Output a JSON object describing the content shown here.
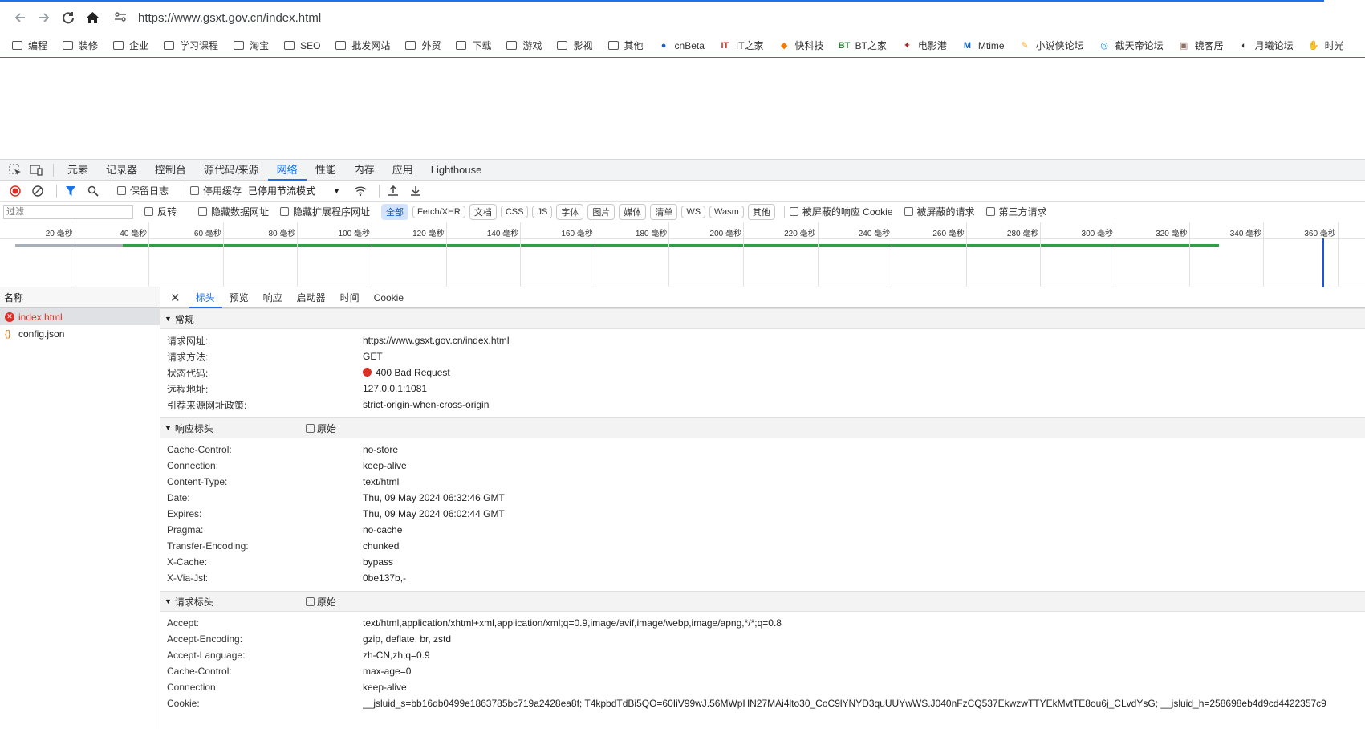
{
  "browser": {
    "url": "https://www.gsxt.gov.cn/index.html",
    "bookmarks": [
      {
        "label": "编程",
        "icon": "folder-icon"
      },
      {
        "label": "装修",
        "icon": "folder-icon"
      },
      {
        "label": "企业",
        "icon": "folder-icon"
      },
      {
        "label": "学习课程",
        "icon": "folder-icon"
      },
      {
        "label": "淘宝",
        "icon": "folder-icon"
      },
      {
        "label": "SEO",
        "icon": "folder-icon"
      },
      {
        "label": "批发网站",
        "icon": "folder-icon"
      },
      {
        "label": "外贸",
        "icon": "folder-icon"
      },
      {
        "label": "下载",
        "icon": "folder-icon"
      },
      {
        "label": "游戏",
        "icon": "folder-icon"
      },
      {
        "label": "影视",
        "icon": "folder-icon"
      },
      {
        "label": "其他",
        "icon": "folder-icon"
      },
      {
        "label": "cnBeta",
        "icon": "cnbeta-icon"
      },
      {
        "label": "IT之家",
        "icon": "ithome-icon"
      },
      {
        "label": "快科技",
        "icon": "kkj-icon"
      },
      {
        "label": "BT之家",
        "icon": "btzj-icon"
      },
      {
        "label": "电影港",
        "icon": "dyg-icon"
      },
      {
        "label": "Mtime",
        "icon": "mtime-icon"
      },
      {
        "label": "小说侠论坛",
        "icon": "xsx-icon"
      },
      {
        "label": "截天帝论坛",
        "icon": "jtd-icon"
      },
      {
        "label": "镜客居",
        "icon": "jkj-icon"
      },
      {
        "label": "月曦论坛",
        "icon": "globe-icon"
      },
      {
        "label": "时光",
        "icon": "sg-icon"
      }
    ]
  },
  "devtools": {
    "tabs": [
      "元素",
      "记录器",
      "控制台",
      "源代码/来源",
      "网络",
      "性能",
      "内存",
      "应用",
      "Lighthouse"
    ],
    "active_tab": "网络",
    "toolbar": {
      "preserve_log": "保留日志",
      "disable_cache": "停用缓存",
      "throttling": "已停用节流模式"
    },
    "filter": {
      "placeholder": "过滤",
      "invert": "反转",
      "hide_data_urls": "隐藏数据网址",
      "hide_ext_urls": "隐藏扩展程序网址",
      "types": [
        "全部",
        "Fetch/XHR",
        "文档",
        "CSS",
        "JS",
        "字体",
        "图片",
        "媒体",
        "清单",
        "WS",
        "Wasm",
        "其他"
      ],
      "active_type": "全部",
      "blocked_cookies": "被屏蔽的响应 Cookie",
      "blocked_requests": "被屏蔽的请求",
      "third_party": "第三方请求"
    },
    "timeline": {
      "ticks": [
        "20 毫秒",
        "40 毫秒",
        "60 毫秒",
        "80 毫秒",
        "100 毫秒",
        "120 毫秒",
        "140 毫秒",
        "160 毫秒",
        "180 毫秒",
        "200 毫秒",
        "220 毫秒",
        "240 毫秒",
        "260 毫秒",
        "280 毫秒",
        "300 毫秒",
        "320 毫秒",
        "340 毫秒",
        "360 毫秒"
      ],
      "request_start_ms": 4,
      "waiting_start_ms": 33,
      "request_end_ms": 328,
      "dom_content_loaded_ms": 356,
      "load_ms": 360
    },
    "requests": {
      "header": "名称",
      "items": [
        {
          "name": "index.html",
          "status": "error"
        },
        {
          "name": "config.json",
          "status": "ok"
        }
      ]
    },
    "detail": {
      "tabs": [
        "标头",
        "预览",
        "响应",
        "启动器",
        "时间",
        "Cookie"
      ],
      "active_tab": "标头",
      "general": {
        "title": "常规",
        "rows": [
          {
            "k": "请求网址:",
            "v": "https://www.gsxt.gov.cn/index.html"
          },
          {
            "k": "请求方法:",
            "v": "GET"
          },
          {
            "k": "状态代码:",
            "v": "400 Bad Request"
          },
          {
            "k": "远程地址:",
            "v": "127.0.0.1:1081"
          },
          {
            "k": "引荐来源网址政策:",
            "v": "strict-origin-when-cross-origin"
          }
        ]
      },
      "response_headers": {
        "title": "响应标头",
        "raw": "原始",
        "rows": [
          {
            "k": "Cache-Control:",
            "v": "no-store"
          },
          {
            "k": "Connection:",
            "v": "keep-alive"
          },
          {
            "k": "Content-Type:",
            "v": "text/html"
          },
          {
            "k": "Date:",
            "v": "Thu, 09 May 2024 06:32:46 GMT"
          },
          {
            "k": "Expires:",
            "v": "Thu, 09 May 2024 06:02:44 GMT"
          },
          {
            "k": "Pragma:",
            "v": "no-cache"
          },
          {
            "k": "Transfer-Encoding:",
            "v": "chunked"
          },
          {
            "k": "X-Cache:",
            "v": "bypass"
          },
          {
            "k": "X-Via-Jsl:",
            "v": "0be137b,-"
          }
        ]
      },
      "request_headers": {
        "title": "请求标头",
        "raw": "原始",
        "rows": [
          {
            "k": "Accept:",
            "v": "text/html,application/xhtml+xml,application/xml;q=0.9,image/avif,image/webp,image/apng,*/*;q=0.8"
          },
          {
            "k": "Accept-Encoding:",
            "v": "gzip, deflate, br, zstd"
          },
          {
            "k": "Accept-Language:",
            "v": "zh-CN,zh;q=0.9"
          },
          {
            "k": "Cache-Control:",
            "v": "max-age=0"
          },
          {
            "k": "Connection:",
            "v": "keep-alive"
          },
          {
            "k": "Cookie:",
            "v": "__jsluid_s=bb16db0499e1863785bc719a2428ea8f; T4kpbdTdBi5QO=60IiV99wJ.56MWpHN27MAi4lto30_CoC9lYNYD3quUUYwWS.J040nFzCQ537EkwzwTTYEkMvtTE8ou6j_CLvdYsG; __jsluid_h=258698eb4d9cd4422357c9"
          }
        ]
      }
    }
  }
}
